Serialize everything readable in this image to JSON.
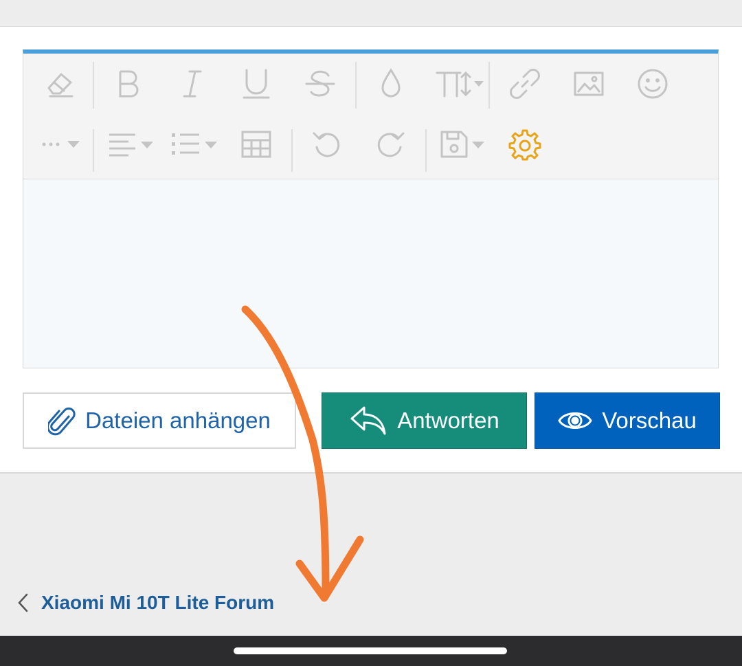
{
  "editor": {
    "toolbar": {
      "row1": [
        "eraser-icon",
        "bold-icon",
        "italic-icon",
        "underline-icon",
        "strikethrough-icon",
        "color-drop-icon",
        "font-size-icon",
        "link-icon",
        "image-icon",
        "smiley-icon"
      ],
      "row2": [
        "more-options-icon",
        "align-icon",
        "list-icon",
        "table-icon",
        "undo-icon",
        "redo-icon",
        "save-draft-icon",
        "gear-icon"
      ],
      "icon_color": "#c4c4c4",
      "gear_color": "#e8a317"
    },
    "content": ""
  },
  "actions": {
    "attach_label": "Dateien anhängen",
    "reply_label": "Antworten",
    "preview_label": "Vorschau"
  },
  "breadcrumb": {
    "label": "Xiaomi Mi 10T Lite Forum"
  },
  "colors": {
    "accent": "#4a9fd8",
    "reply_button": "#168c7b",
    "preview_button": "#0062bc",
    "link": "#1d5e9a",
    "annotation_arrow": "#f07a32"
  }
}
